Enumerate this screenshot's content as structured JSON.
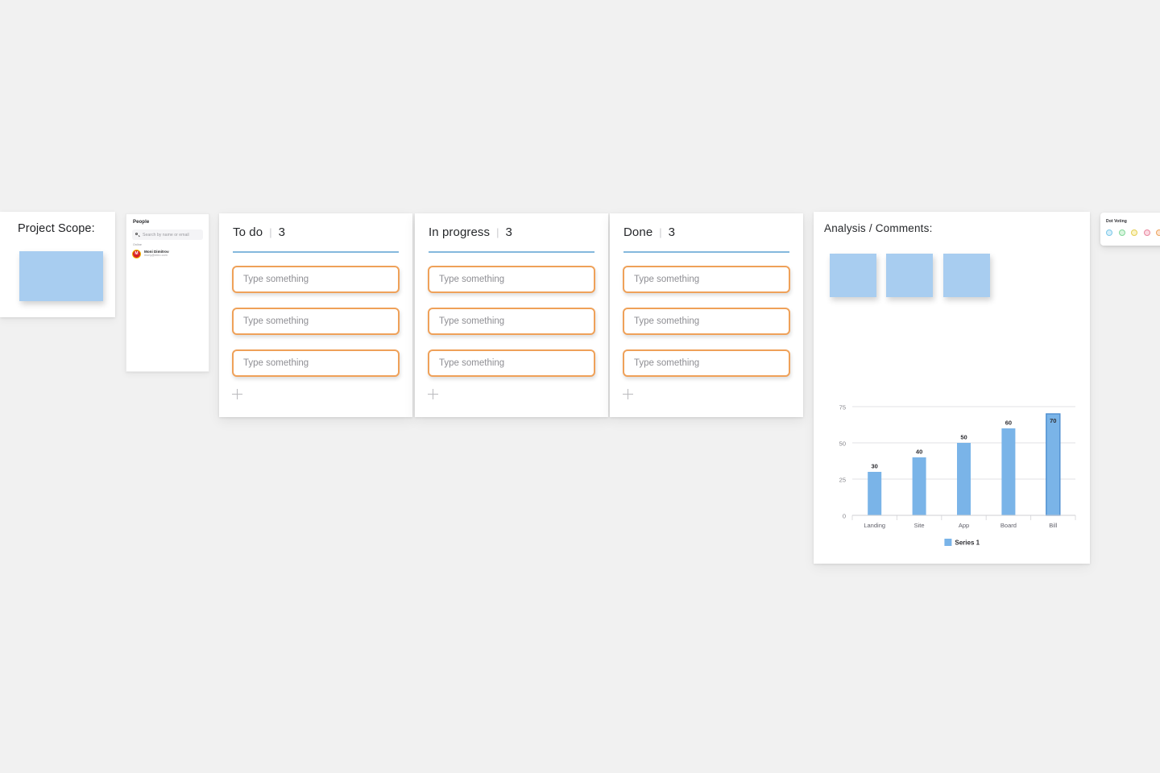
{
  "board": {
    "background_color": "#f1f1f1"
  },
  "project_scope": {
    "title": "Project Scope:",
    "note_color": "#a8cdf0"
  },
  "people": {
    "title": "People",
    "search": {
      "placeholder": "Search by name or email",
      "value": "",
      "icon": "search-icon"
    },
    "status_label": "Online",
    "members": [
      {
        "initial": "M",
        "name": "Moni Dimitrov",
        "email": "mony@miro.com",
        "avatar_color": "#d81f26",
        "avatar_ring_color": "#f0b400"
      }
    ]
  },
  "kanban": {
    "card_border_color": "#efa159",
    "rule_color": "#84b8dd",
    "add_label": "+",
    "columns": [
      {
        "title": "To do",
        "separator": "|",
        "count": "3",
        "cards": [
          {
            "placeholder": "Type something",
            "value": ""
          },
          {
            "placeholder": "Type something",
            "value": ""
          },
          {
            "placeholder": "Type something",
            "value": ""
          }
        ]
      },
      {
        "title": "In progress",
        "separator": "|",
        "count": "3",
        "cards": [
          {
            "placeholder": "Type something",
            "value": ""
          },
          {
            "placeholder": "Type something",
            "value": ""
          },
          {
            "placeholder": "Type something",
            "value": ""
          }
        ]
      },
      {
        "title": "Done",
        "separator": "|",
        "count": "3",
        "cards": [
          {
            "placeholder": "Type something",
            "value": ""
          },
          {
            "placeholder": "Type something",
            "value": ""
          },
          {
            "placeholder": "Type something",
            "value": ""
          }
        ]
      }
    ]
  },
  "analysis": {
    "title": "Analysis / Comments:",
    "notes": [
      {
        "color": "#a8cdf0"
      },
      {
        "color": "#a8cdf0"
      },
      {
        "color": "#a8cdf0"
      }
    ]
  },
  "dot_voting": {
    "title": "Dot Voting",
    "swatches": [
      {
        "name": "blue",
        "fill": "#d6effa",
        "stroke": "#7cc8e8"
      },
      {
        "name": "green",
        "fill": "#d8f5de",
        "stroke": "#83d79a"
      },
      {
        "name": "yellow",
        "fill": "#fbf3c4",
        "stroke": "#e3cf55"
      },
      {
        "name": "pink",
        "fill": "#fbd9e2",
        "stroke": "#e8879f"
      },
      {
        "name": "orange",
        "fill": "#fde4cf",
        "stroke": "#eda45f"
      }
    ]
  },
  "chart_data": {
    "type": "bar",
    "title": "",
    "xlabel": "",
    "ylabel": "",
    "categories": [
      "Landing",
      "Site",
      "App",
      "Board",
      "Bill"
    ],
    "values": [
      30,
      40,
      50,
      60,
      70
    ],
    "data_labels": [
      "30",
      "40",
      "50",
      "60",
      "70"
    ],
    "ytick_labels": [
      "0",
      "25",
      "50",
      "75"
    ],
    "yticks": [
      0,
      25,
      50,
      75
    ],
    "ylim": [
      0,
      80
    ],
    "grid": true,
    "legend": {
      "position": "bottom",
      "entries": [
        {
          "name": "Series 1",
          "color": "#7ab4e8"
        }
      ]
    },
    "series": [
      {
        "name": "Series 1",
        "values": [
          30,
          40,
          50,
          60,
          70
        ],
        "color": "#7ab4e8",
        "highlight_index": 4,
        "highlight_stroke": "#4f8fd0"
      }
    ]
  }
}
